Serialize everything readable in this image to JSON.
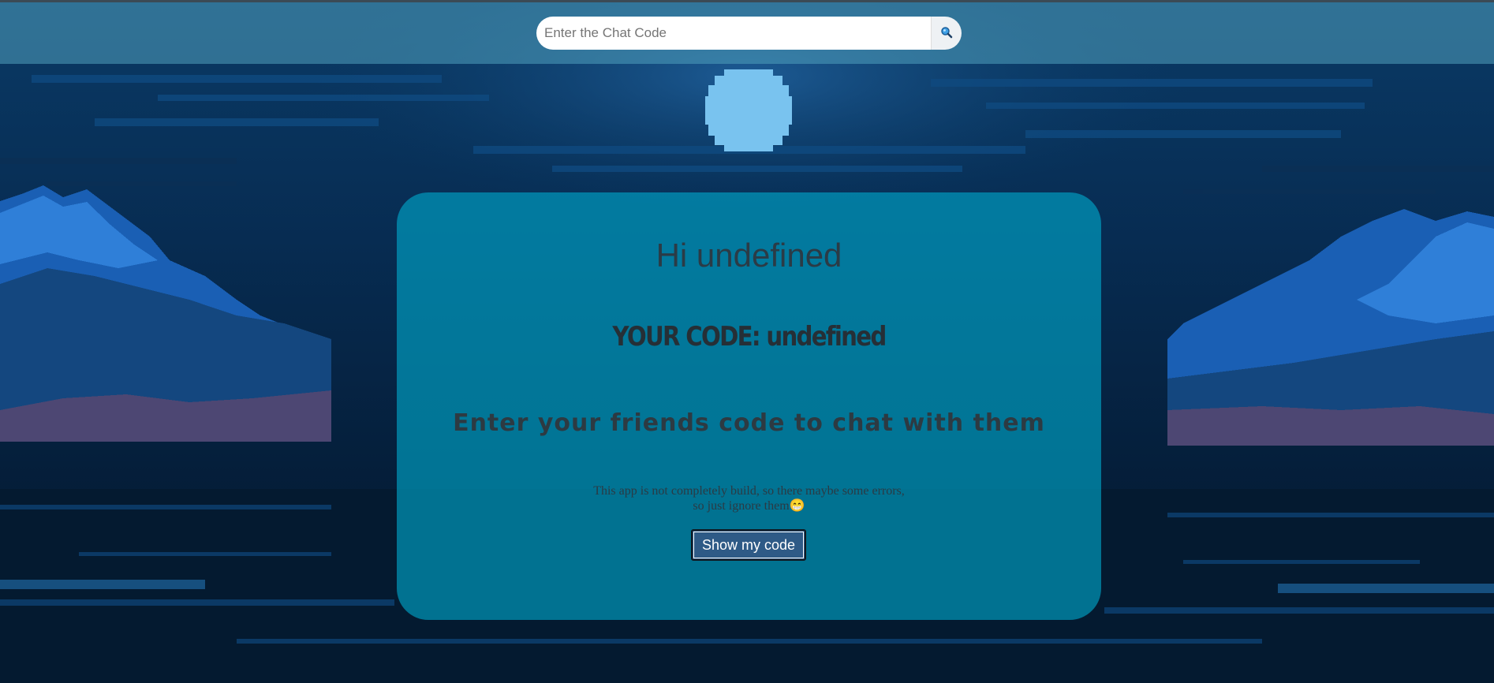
{
  "search": {
    "placeholder": "Enter the Chat Code",
    "value": "",
    "button_icon": "search-icon"
  },
  "card": {
    "greeting": "Hi undefined",
    "code_line": "YOUR CODE: undefined",
    "instruction": "Enter your friends code to chat with them",
    "notice_line1": "This app is not completely build, so there maybe some errors,",
    "notice_line2": "so just ignore them",
    "notice_emoji": "😁",
    "show_button_label": "Show my code"
  },
  "colors": {
    "topbar": "#4f9fbe",
    "card": "#00aacd",
    "button": "#2e5a86",
    "moon": "#79c3ef",
    "mountains": "#1565c0"
  }
}
